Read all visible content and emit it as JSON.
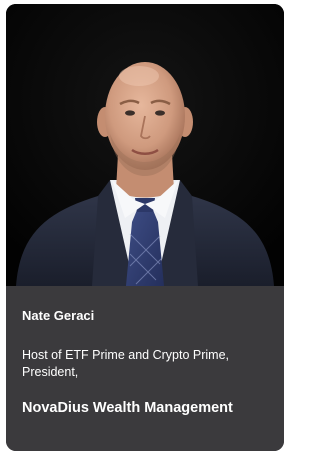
{
  "profile": {
    "name": "Nate Geraci",
    "role": "Host of ETF Prime and Crypto Prime, President,",
    "company": "NovaDius Wealth Management"
  },
  "colors": {
    "card_background": "#3b3a3d",
    "photo_background": "#050505",
    "text": "#ffffff"
  }
}
